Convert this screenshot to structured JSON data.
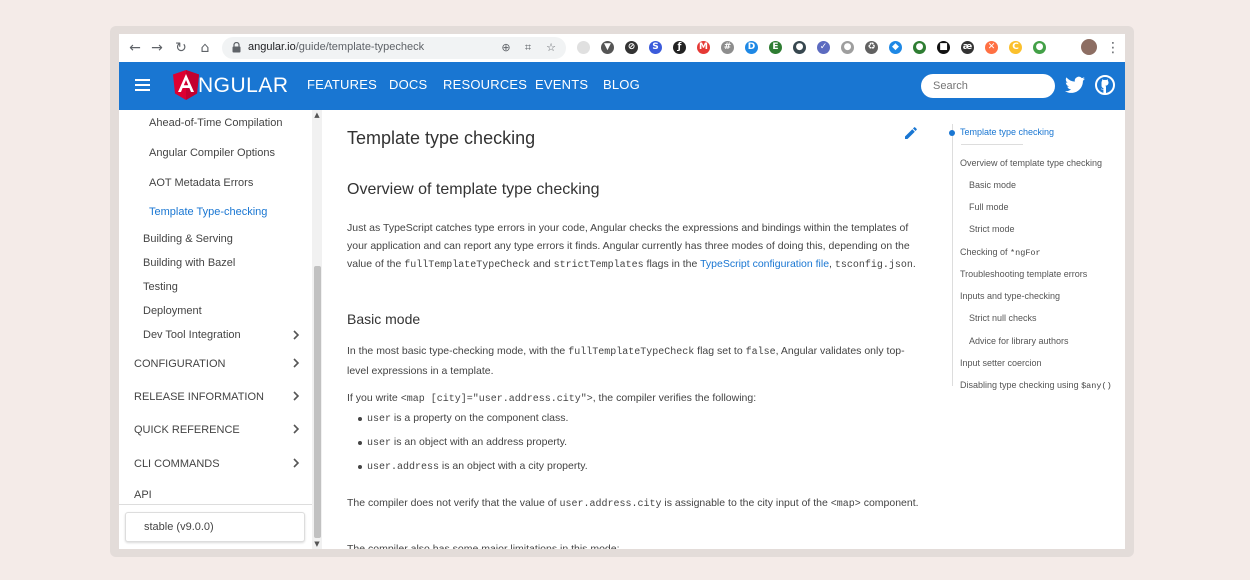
{
  "browser": {
    "url_host": "angular.io",
    "url_path": "/guide/template-typecheck",
    "extensions": [
      {
        "name": "ext-square",
        "color": "#e0e0e0",
        "glyph": ""
      },
      {
        "name": "ext-v",
        "color": "#555555",
        "glyph": "▼"
      },
      {
        "name": "ext-circle-slash",
        "color": "#333333",
        "glyph": "⊘"
      },
      {
        "name": "ext-blue-s",
        "color": "#3b5bdb",
        "glyph": "S"
      },
      {
        "name": "ext-fx",
        "color": "#222222",
        "glyph": "ƒ"
      },
      {
        "name": "ext-red",
        "color": "#e53935",
        "glyph": "M"
      },
      {
        "name": "ext-grid",
        "color": "#8d8d8d",
        "glyph": "#"
      },
      {
        "name": "ext-cyan",
        "color": "#1e88e5",
        "glyph": "D"
      },
      {
        "name": "ext-evernote",
        "color": "#2e7d32",
        "glyph": "E"
      },
      {
        "name": "ext-dark",
        "color": "#37474f",
        "glyph": "●"
      },
      {
        "name": "ext-purple",
        "color": "#5c6bc0",
        "glyph": "✓"
      },
      {
        "name": "ext-grey-circle",
        "color": "#9e9e9e",
        "glyph": "●"
      },
      {
        "name": "ext-recycle",
        "color": "#616161",
        "glyph": "♻"
      },
      {
        "name": "ext-dropbox",
        "color": "#1e88e5",
        "glyph": "◆"
      },
      {
        "name": "ext-green-drop",
        "color": "#2e7d32",
        "glyph": "●"
      },
      {
        "name": "ext-black-square",
        "color": "#111111",
        "glyph": "■"
      },
      {
        "name": "ext-ae",
        "color": "#333333",
        "glyph": "æ"
      },
      {
        "name": "ext-orange",
        "color": "#ff7043",
        "glyph": "✕"
      },
      {
        "name": "ext-yellow",
        "color": "#fbc02d",
        "glyph": "C"
      },
      {
        "name": "ext-chrome",
        "color": "#43a047",
        "glyph": "●"
      }
    ]
  },
  "header": {
    "brand": "NGULAR",
    "nav": [
      "FEATURES",
      "DOCS",
      "RESOURCES",
      "EVENTS",
      "BLOG"
    ],
    "search_placeholder": "Search",
    "bar_color": "#1976d2"
  },
  "sidenav": {
    "items": [
      {
        "label": "Ahead-of-Time Compilation",
        "level": 2
      },
      {
        "label": "Angular Compiler Options",
        "level": 2
      },
      {
        "label": "AOT Metadata Errors",
        "level": 2
      },
      {
        "label": "Template Type-checking",
        "level": 2,
        "active": true
      },
      {
        "label": "Building & Serving",
        "level": 1
      },
      {
        "label": "Building with Bazel",
        "level": 1
      },
      {
        "label": "Testing",
        "level": 1
      },
      {
        "label": "Deployment",
        "level": 1
      },
      {
        "label": "Dev Tool Integration",
        "level": 1,
        "chevron": true
      }
    ],
    "sections": [
      {
        "label": "CONFIGURATION",
        "chevron": true
      },
      {
        "label": "RELEASE INFORMATION",
        "chevron": true
      },
      {
        "label": "QUICK REFERENCE",
        "chevron": true
      },
      {
        "label": "CLI COMMANDS",
        "chevron": true
      },
      {
        "label": "API",
        "chevron": false
      }
    ],
    "version": "stable (v9.0.0)"
  },
  "content": {
    "page_title": "Template type checking",
    "overview_heading": "Overview of template type checking",
    "p1_a": "Just as TypeScript catches type errors in your code, Angular checks the expressions and bindings within the templates of your application and can report any type errors it finds. Angular currently has three modes of doing this, depending on the value of the ",
    "p1_code1": "fullTemplateTypeCheck",
    "p1_b": " and ",
    "p1_code2": "strictTemplates",
    "p1_c": " flags in the ",
    "p1_link": "TypeScript configuration file",
    "p1_d": ", ",
    "p1_code3": "tsconfig.json",
    "p1_e": ".",
    "basic_heading": "Basic mode",
    "p2_a": "In the most basic type-checking mode, with the ",
    "p2_code1": "fullTemplateTypeCheck",
    "p2_b": " flag set to ",
    "p2_code2": "false",
    "p2_c": ", Angular validates only top-level expressions in a template.",
    "p3_a": "If you write ",
    "p3_code": "<map [city]=\"user.address.city\">",
    "p3_b": ", the compiler verifies the following:",
    "bullets": [
      {
        "code": "user",
        "text": " is a property on the component class."
      },
      {
        "code": "user",
        "text": " is an object with an address property."
      },
      {
        "code": "user.address",
        "text": " is an object with a city property."
      }
    ],
    "p4_a": "The compiler does not verify that the value of ",
    "p4_code1": "user.address.city",
    "p4_b": " is assignable to the city input of the ",
    "p4_code2": "<map>",
    "p4_c": " component.",
    "p5": "The compiler also has some major limitations in this mode:"
  },
  "toc": {
    "items": [
      {
        "label": "Template type checking",
        "indent": 0,
        "active": true
      },
      {
        "label": "Overview of template type checking",
        "indent": 0
      },
      {
        "label": "Basic mode",
        "indent": 1
      },
      {
        "label": "Full mode",
        "indent": 1
      },
      {
        "label": "Strict mode",
        "indent": 1
      },
      {
        "label": "Checking of ",
        "code": "*ngFor",
        "indent": 0
      },
      {
        "label": "Troubleshooting template errors",
        "indent": 0
      },
      {
        "label": "Inputs and type-checking",
        "indent": 0
      },
      {
        "label": "Strict null checks",
        "indent": 1
      },
      {
        "label": "Advice for library authors",
        "indent": 1
      },
      {
        "label": "Input setter coercion",
        "indent": 0
      },
      {
        "label": "Disabling type checking using ",
        "code": "$any()",
        "indent": 0
      }
    ]
  }
}
